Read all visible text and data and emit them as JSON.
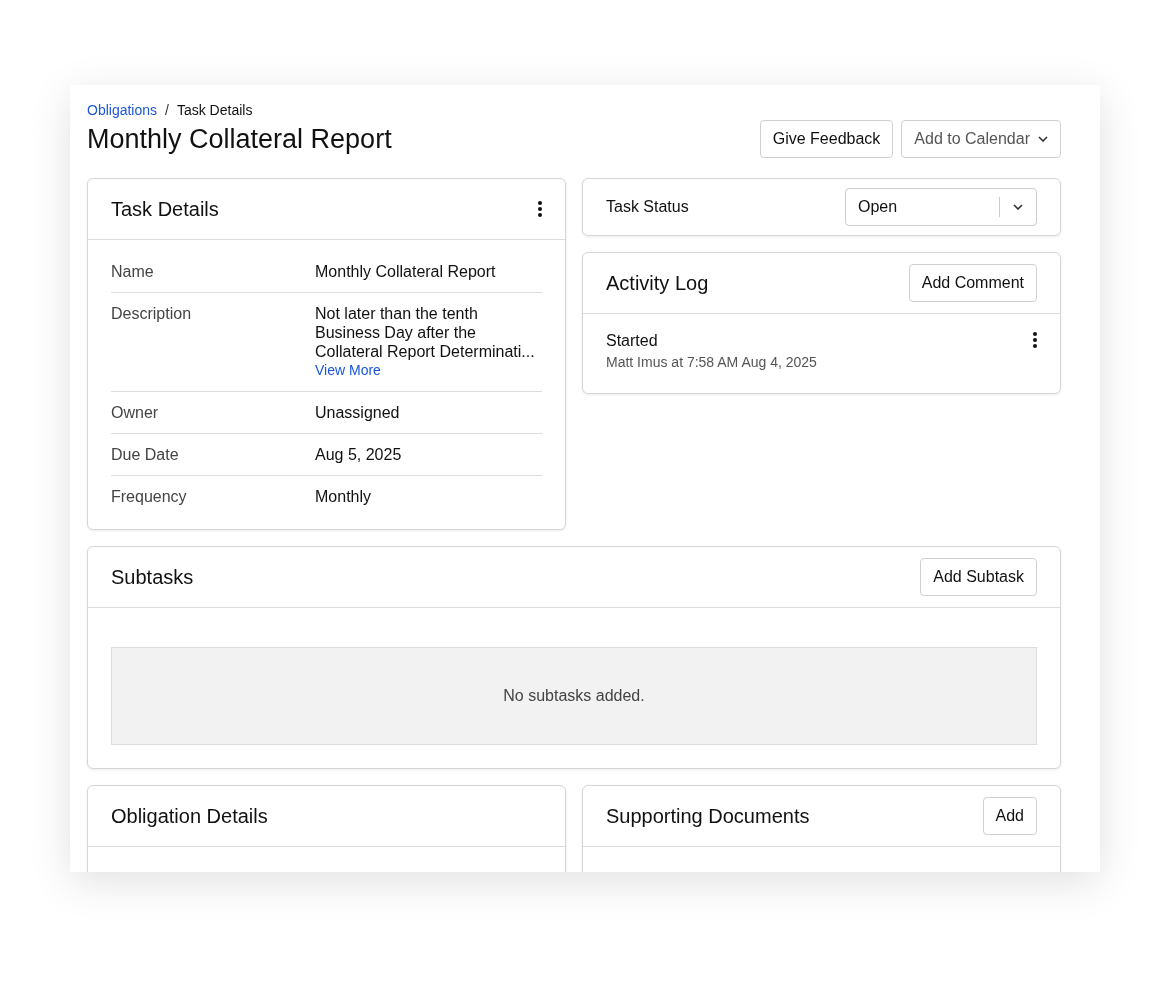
{
  "breadcrumb_separator": "/",
  "breadcrumb": [
    {
      "label": "Obligations",
      "link": true
    },
    {
      "label": "Task Details",
      "link": false
    }
  ],
  "title": "Monthly Collateral Report",
  "header_buttons": [
    {
      "label": "Give Feedback",
      "kind": "plain"
    },
    {
      "label": "Add to Calendar",
      "kind": "dropdown"
    }
  ],
  "task_details": {
    "title": "Task Details",
    "rows": [
      {
        "label": "Name",
        "value": "Monthly Collateral Report"
      },
      {
        "label": "Description",
        "value": "Not later than the tenth Business Day after the Collateral Report Determinati...",
        "link": "View More"
      },
      {
        "label": "Owner",
        "value": "Unassigned"
      },
      {
        "label": "Due Date",
        "value": "Aug 5, 2025"
      },
      {
        "label": "Frequency",
        "value": "Monthly"
      }
    ]
  },
  "task_status": {
    "label": "Task Status",
    "value": "Open"
  },
  "activity_log": {
    "title": "Activity Log",
    "button": "Add Comment",
    "entries": [
      {
        "title": "Started",
        "meta": "Matt Imus at 7:58 AM Aug 4, 2025"
      }
    ]
  },
  "subtasks": {
    "title": "Subtasks",
    "button": "Add Subtask",
    "empty": "No subtasks added."
  },
  "obligation_details": {
    "title": "Obligation Details"
  },
  "supporting_documents": {
    "title": "Supporting Documents",
    "button": "Add"
  }
}
